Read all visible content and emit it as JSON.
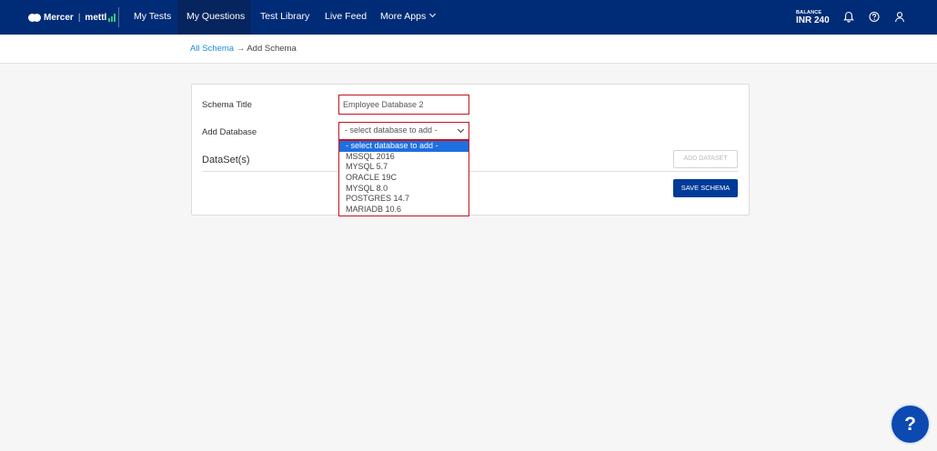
{
  "nav": {
    "brand": "Mercer",
    "product": "mettl",
    "items": [
      {
        "label": "My Tests",
        "active": false
      },
      {
        "label": "My Questions",
        "active": true
      },
      {
        "label": "Test Library",
        "active": false
      },
      {
        "label": "Live Feed",
        "active": false
      },
      {
        "label": "More Apps",
        "active": false
      }
    ],
    "balance_label": "BALANCE",
    "balance_value": "INR 240",
    "icons": [
      "bell-icon",
      "help-circle-icon",
      "user-icon"
    ]
  },
  "breadcrumb": {
    "link": "All Schema",
    "arrow": "→",
    "current": "Add Schema"
  },
  "form": {
    "schema_title_label": "Schema Title",
    "schema_title_value": "Employee Database 2",
    "add_database_label": "Add Database",
    "select_value": "- select database to add -",
    "options": [
      "- select database to add -",
      "MSSQL 2016",
      "MYSQL 5.7",
      "ORACLE 19C",
      "MYSQL 8.0",
      "POSTGRES 14.7",
      "MARIADB 10.6"
    ],
    "selected_index": 0,
    "datasets_heading": "DataSet(s)",
    "add_dataset_label": "ADD DATASET",
    "save_label": "SAVE SCHEMA"
  },
  "help": {
    "label": "?"
  },
  "colors": {
    "nav_bg": "#002c77",
    "accent": "#003b99",
    "link": "#1a8fd8",
    "highlight_border": "#c0141f",
    "selected_option": "#1e6fe0"
  }
}
